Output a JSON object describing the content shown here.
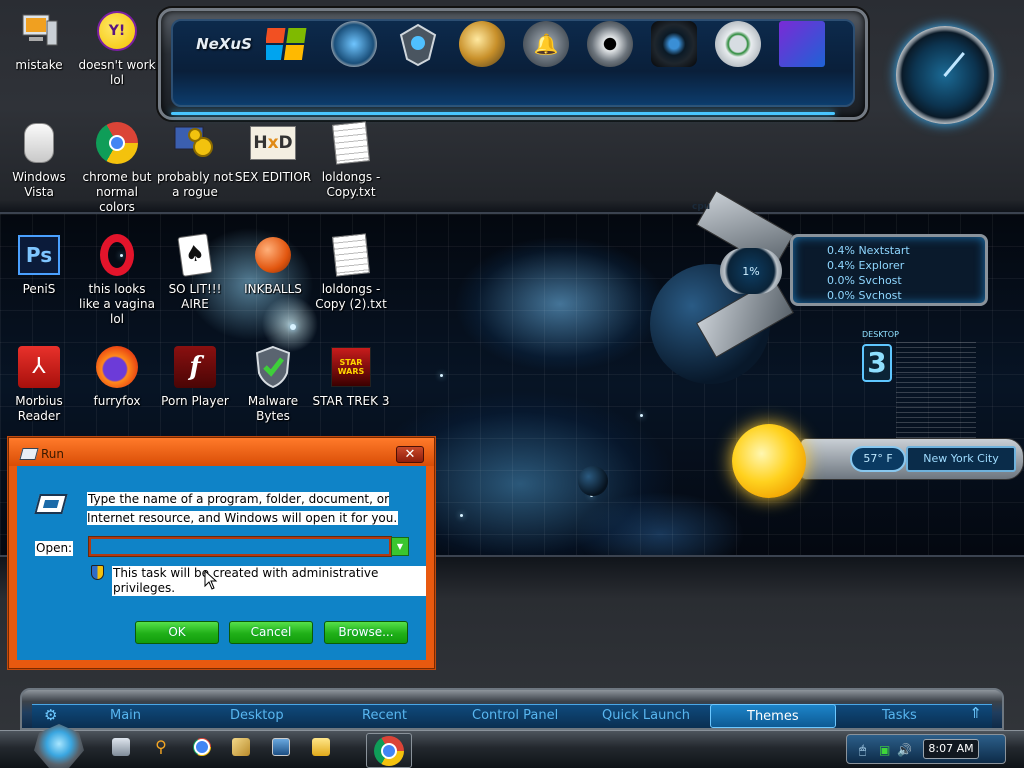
{
  "desktop_icons": [
    {
      "label": "mistake",
      "icon": "computer-icon"
    },
    {
      "label": "doesn't work lol",
      "icon": "yahoo-messenger-icon"
    },
    {
      "label": "Windows Vista",
      "icon": "vista-icon"
    },
    {
      "label": "chrome but normal colors",
      "icon": "chrome-icon"
    },
    {
      "label": "probably not a rogue",
      "icon": "gears-icon"
    },
    {
      "label": "SEX EDITIOR",
      "icon": "hxd-icon"
    },
    {
      "label": "loldongs - Copy.txt",
      "icon": "text-file-icon"
    },
    {
      "label": "PeniS",
      "icon": "photoshop-icon"
    },
    {
      "label": "this looks like a vagina lol",
      "icon": "opera-icon"
    },
    {
      "label": "SO LIT!!! AIRE",
      "icon": "solitaire-icon"
    },
    {
      "label": "INKBALLS",
      "icon": "inkball-icon"
    },
    {
      "label": "loldongs - Copy (2).txt",
      "icon": "text-file-icon"
    },
    {
      "label": "Morbius Reader",
      "icon": "pdf-reader-icon"
    },
    {
      "label": "furryfox",
      "icon": "firefox-icon"
    },
    {
      "label": "Porn Player",
      "icon": "flash-player-icon"
    },
    {
      "label": "Malware Bytes",
      "icon": "shield-icon"
    },
    {
      "label": "STAR TREK 3",
      "icon": "star-wars-icon"
    }
  ],
  "top_dock": {
    "items": [
      "nexus-icon",
      "windows-icon",
      "network-icon",
      "shield-wing-icon",
      "globe-icon",
      "bell-icon",
      "speaker-icon",
      "camera-icon",
      "gauge-icon",
      "monitor-icon"
    ],
    "nexus_label": "NeXuS"
  },
  "cpu_gadget": {
    "tag": "cpu",
    "usage": "1%",
    "processes": [
      "0.4% Nextstart",
      "0.4% Explorer",
      "0.0% Svchost",
      "0.0% Svchost"
    ]
  },
  "desktop_counter": {
    "caption": "DESKTOP",
    "number": "3"
  },
  "weather": {
    "temperature": "57° F",
    "city": "New York City"
  },
  "run_dialog": {
    "title": "Run",
    "close_label": "✕",
    "description": "Type the name of a program, folder, document, or Internet resource, and Windows will open it for you.",
    "open_label": "Open:",
    "open_value": "",
    "admin_note": "This task will be created with administrative privileges.",
    "ok_label": "OK",
    "cancel_label": "Cancel",
    "browse_label": "Browse..."
  },
  "launcher": {
    "tabs": [
      "Main",
      "Desktop",
      "Recent",
      "Control Panel",
      "Quick Launch",
      "Themes",
      "Tasks"
    ],
    "active_tab": "Themes"
  },
  "taskbar": {
    "quick_launch": [
      "show-desktop-icon",
      "search-icon",
      "chrome-icon",
      "library-icon",
      "window-switch-icon",
      "folder-icon"
    ],
    "active_app": "chrome-icon",
    "clock": "8:07 AM"
  },
  "colors": {
    "dialog_border": "#e8590f",
    "dialog_body": "#0f83c7",
    "button_green": "#20b018",
    "accent_blue": "#49c6ff"
  }
}
